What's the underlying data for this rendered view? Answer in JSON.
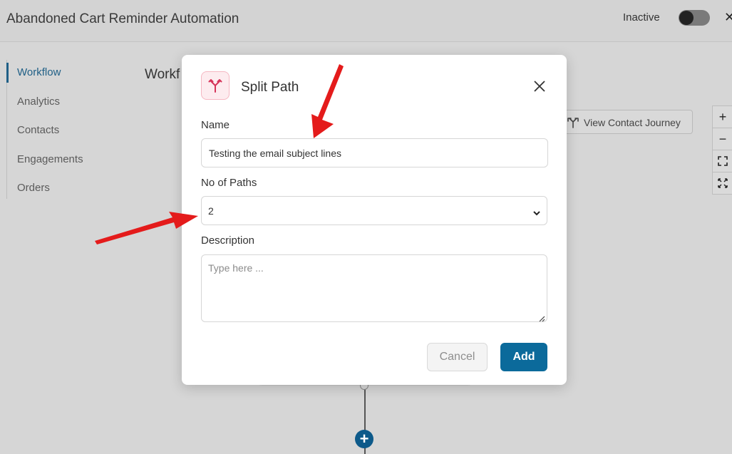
{
  "header": {
    "title": "Abandoned Cart Reminder Automation",
    "status_label": "Inactive",
    "toggle_on": false
  },
  "sidebar": {
    "items": [
      {
        "label": "Workflow",
        "active": true
      },
      {
        "label": "Analytics",
        "active": false
      },
      {
        "label": "Contacts",
        "active": false
      },
      {
        "label": "Engagements",
        "active": false
      },
      {
        "label": "Orders",
        "active": false
      }
    ]
  },
  "canvas": {
    "title": "Workf",
    "journey_button": "View Contact Journey",
    "zoom_controls": [
      "plus-icon",
      "minus-icon",
      "fit-screen-icon",
      "expand-icon"
    ]
  },
  "modal": {
    "title": "Split Path",
    "name_label": "Name",
    "name_value": "Testing the email subject lines",
    "paths_label": "No of Paths",
    "paths_value": "2",
    "description_label": "Description",
    "description_placeholder": "Type here ...",
    "cancel_label": "Cancel",
    "add_label": "Add"
  },
  "colors": {
    "accent": "#0b6a9b",
    "icon_pink": "#d6355a",
    "arrow_red": "#e41b1b"
  }
}
